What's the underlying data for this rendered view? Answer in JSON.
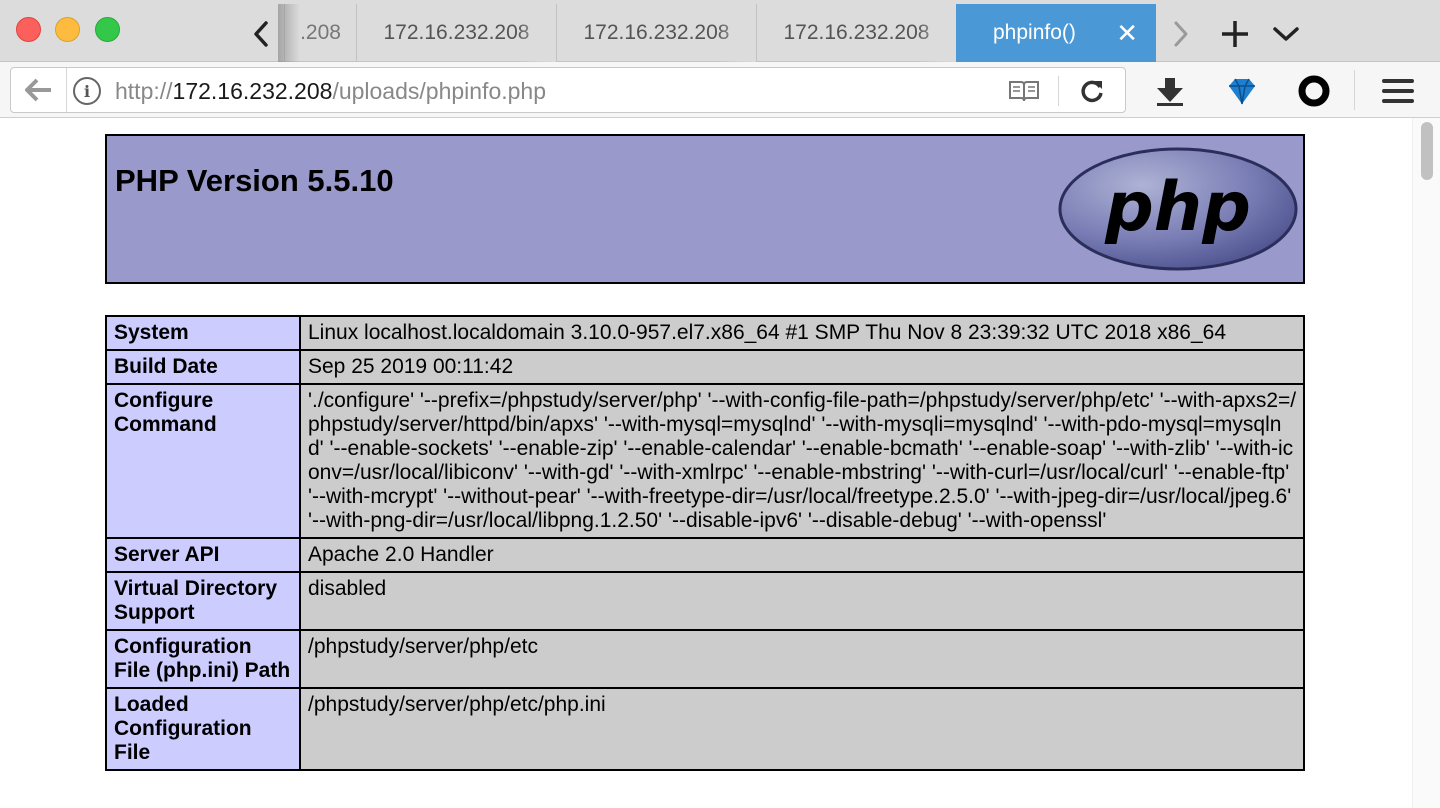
{
  "browser": {
    "tabs": [
      {
        "label": ".208"
      },
      {
        "label": "172.16.232.208"
      },
      {
        "label": "172.16.232.208"
      },
      {
        "label": "172.16.232.208"
      },
      {
        "label": "phpinfo()",
        "active": true
      }
    ],
    "url": {
      "scheme": "http://",
      "host": "172.16.232.208",
      "path": "/uploads/phpinfo.php"
    }
  },
  "page": {
    "title": "PHP Version 5.5.10",
    "logo_text": "php",
    "rows": [
      {
        "key": "System",
        "value": "Linux localhost.localdomain 3.10.0-957.el7.x86_64 #1 SMP Thu Nov 8 23:39:32 UTC 2018 x86_64"
      },
      {
        "key": "Build Date",
        "value": "Sep 25 2019 00:11:42"
      },
      {
        "key": "Configure Command",
        "value": "'./configure' '--prefix=/phpstudy/server/php' '--with-config-file-path=/phpstudy/server/php/etc' '--with-apxs2=/phpstudy/server/httpd/bin/apxs' '--with-mysql=mysqlnd' '--with-mysqli=mysqlnd' '--with-pdo-mysql=mysqlnd' '--enable-sockets' '--enable-zip' '--enable-calendar' '--enable-bcmath' '--enable-soap' '--with-zlib' '--with-iconv=/usr/local/libiconv' '--with-gd' '--with-xmlrpc' '--enable-mbstring' '--with-curl=/usr/local/curl' '--enable-ftp' '--with-mcrypt' '--without-pear' '--with-freetype-dir=/usr/local/freetype.2.5.0' '--with-jpeg-dir=/usr/local/jpeg.6' '--with-png-dir=/usr/local/libpng.1.2.50' '--disable-ipv6' '--disable-debug' '--with-openssl'"
      },
      {
        "key": "Server API",
        "value": "Apache 2.0 Handler"
      },
      {
        "key": "Virtual Directory Support",
        "value": "disabled"
      },
      {
        "key": "Configuration File (php.ini) Path",
        "value": "/phpstudy/server/php/etc"
      },
      {
        "key": "Loaded Configuration File",
        "value": "/phpstudy/server/php/etc/php.ini"
      }
    ]
  },
  "colors": {
    "header_bg": "#9999cc",
    "key_bg": "#ccccff",
    "value_bg": "#cccccc",
    "active_tab": "#4b98d7"
  }
}
